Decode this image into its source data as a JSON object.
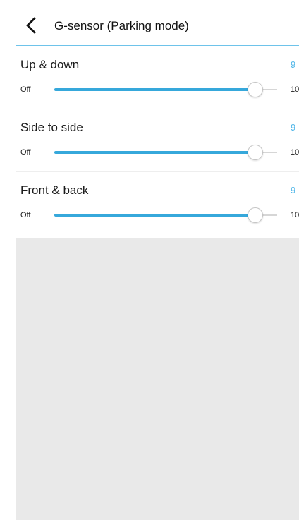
{
  "header": {
    "back_icon": "chevron-left-icon",
    "title": "G-sensor (Parking mode)"
  },
  "settings": [
    {
      "label": "Up & down",
      "value": "9",
      "min_label": "Off",
      "max_label": "10",
      "level": 0.9
    },
    {
      "label": "Side to side",
      "value": "9",
      "min_label": "Off",
      "max_label": "10",
      "level": 0.9
    },
    {
      "label": "Front & back",
      "value": "9",
      "min_label": "Off",
      "max_label": "10",
      "level": 0.9
    }
  ],
  "colors": {
    "accent": "#36a8db",
    "value_text": "#4fb6e8",
    "header_border": "#6ec3ea",
    "background": "#e9e9e9"
  }
}
